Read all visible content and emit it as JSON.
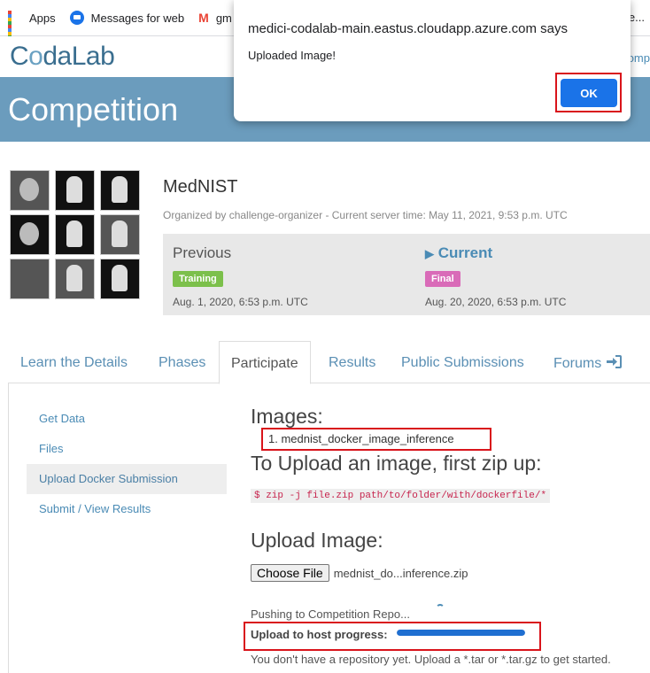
{
  "bookmarks": [
    {
      "label": "Apps",
      "icon": "apps-grid-icon"
    },
    {
      "label": "Messages for web",
      "icon": "messages-icon"
    },
    {
      "label": "gm",
      "icon": "gmail-icon"
    }
  ],
  "header": {
    "logo_pre": "C",
    "logo_o": "o",
    "logo_post": "daLab",
    "right_cut": "omp",
    "right_edge": "e..."
  },
  "banner": {
    "title": "Competition"
  },
  "competition": {
    "name": "MedNIST",
    "organizer_line": "Organized by challenge-organizer - Current server time: May 11, 2021, 9:53 p.m. UTC",
    "phases": [
      {
        "label": "Previous",
        "badge": "Training",
        "date": "Aug. 1, 2020, 6:53 p.m. UTC"
      },
      {
        "label": "Current",
        "badge": "Final",
        "date": "Aug. 20, 2020, 6:53 p.m. UTC",
        "marker": "▶"
      }
    ]
  },
  "tabs": [
    {
      "label": "Learn the Details"
    },
    {
      "label": "Phases"
    },
    {
      "label": "Participate",
      "active": true
    },
    {
      "label": "Results"
    },
    {
      "label": "Public Submissions"
    },
    {
      "label": "Forums",
      "icon": "sign-in-icon"
    }
  ],
  "side_menu": [
    {
      "label": "Get Data"
    },
    {
      "label": "Files"
    },
    {
      "label": "Upload Docker Submission",
      "active": true
    },
    {
      "label": "Submit / View Results"
    }
  ],
  "main": {
    "images_heading": "Images:",
    "images": [
      "1. mednist_docker_image_inference"
    ],
    "to_upload_heading": "To Upload an image, first zip up:",
    "zip_command": "$ zip -j file.zip path/to/folder/with/dockerfile/*",
    "upload_heading": "Upload Image:",
    "choose_file_label": "Choose File",
    "file_name": "mednist_do...inference.zip",
    "pushing_text": "Pushing to Competition Repo...",
    "progress_label": "Upload to host progress:",
    "progress_value": 1.0,
    "no_repo_text": "You don't have a repository yet. Upload a *.tar or *.tar.gz to get started."
  },
  "dialog": {
    "title": "medici-codalab-main.eastus.cloudapp.azure.com says",
    "message": "Uploaded Image!",
    "ok_label": "OK"
  },
  "colors": {
    "accent": "#4a8bb5",
    "banner": "#6b9cbd",
    "highlight": "#d9141b",
    "ok_button": "#1a73e8"
  }
}
